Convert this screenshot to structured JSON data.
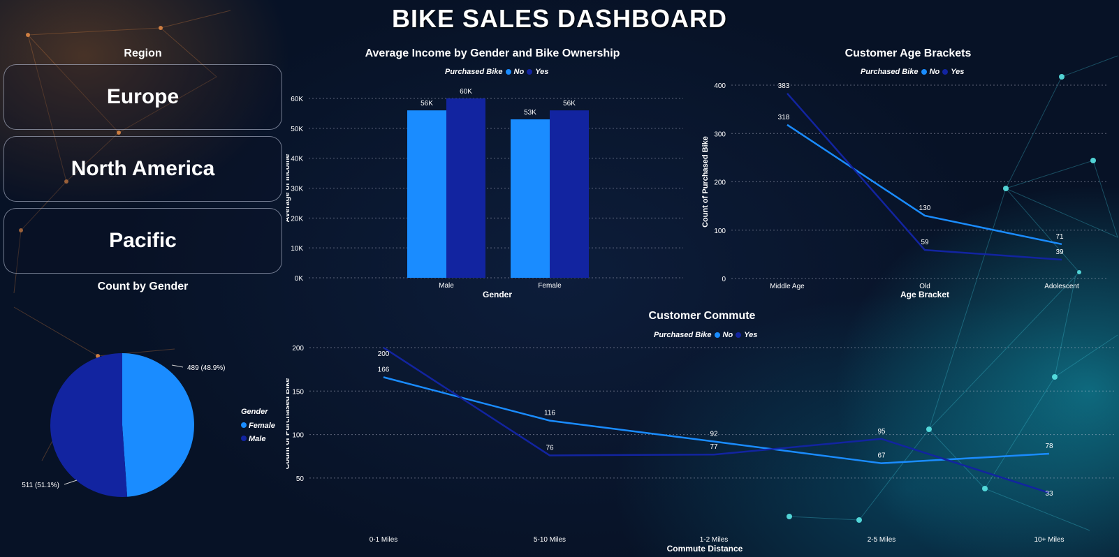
{
  "dashboard": {
    "title": "BIKE SALES DASHBOARD"
  },
  "colors": {
    "no": "#1a8cff",
    "yes": "#1224a0",
    "female": "#1a8cff",
    "male": "#1224a0"
  },
  "region": {
    "title": "Region",
    "options": [
      "Europe",
      "North America",
      "Pacific"
    ]
  },
  "chart_data": [
    {
      "id": "income",
      "type": "bar",
      "title": "Average Income by Gender and Bike Ownership",
      "legend_title": "Purchased Bike",
      "categories": [
        "Male",
        "Female"
      ],
      "series": [
        {
          "name": "No",
          "values": [
            56000,
            53000
          ],
          "labels": [
            "56K",
            "53K"
          ]
        },
        {
          "name": "Yes",
          "values": [
            60000,
            56000
          ],
          "labels": [
            "60K",
            "56K"
          ]
        }
      ],
      "xlabel": "Gender",
      "ylabel": "Average of Income",
      "ylim": [
        0,
        60000
      ],
      "yticks": [
        0,
        10000,
        20000,
        30000,
        40000,
        50000,
        60000
      ],
      "ytick_labels": [
        "0K",
        "10K",
        "20K",
        "30K",
        "40K",
        "50K",
        "60K"
      ],
      "legend": "top",
      "grid": true
    },
    {
      "id": "age",
      "type": "line",
      "title": "Customer Age Brackets",
      "legend_title": "Purchased Bike",
      "categories": [
        "Middle Age",
        "Old",
        "Adolescent"
      ],
      "series": [
        {
          "name": "No",
          "values": [
            318,
            130,
            71
          ]
        },
        {
          "name": "Yes",
          "values": [
            383,
            59,
            39
          ]
        }
      ],
      "xlabel": "Age Bracket",
      "ylabel": "Count of Purchased Bike",
      "ylim": [
        0,
        400
      ],
      "yticks": [
        0,
        100,
        200,
        300,
        400
      ],
      "legend": "top",
      "grid": true
    },
    {
      "id": "commute",
      "type": "line",
      "title": "Customer Commute",
      "legend_title": "Purchased Bike",
      "categories": [
        "0-1 Miles",
        "5-10 Miles",
        "1-2 Miles",
        "2-5 Miles",
        "10+ Miles"
      ],
      "series": [
        {
          "name": "No",
          "values": [
            166,
            116,
            92,
            67,
            78
          ]
        },
        {
          "name": "Yes",
          "values": [
            200,
            76,
            77,
            95,
            33
          ]
        }
      ],
      "xlabel": "Commute Distance",
      "ylabel": "Count of Purchased Bike",
      "ylim": [
        25,
        200
      ],
      "yticks": [
        50,
        100,
        150,
        200
      ],
      "legend": "top",
      "grid": true
    },
    {
      "id": "gender",
      "type": "pie",
      "title": "Count by Gender",
      "legend_title": "Gender",
      "slices": [
        {
          "name": "Female",
          "value": 489,
          "label": "489 (48.9%)"
        },
        {
          "name": "Male",
          "value": 511,
          "label": "511 (51.1%)"
        }
      ],
      "legend": "right"
    }
  ]
}
